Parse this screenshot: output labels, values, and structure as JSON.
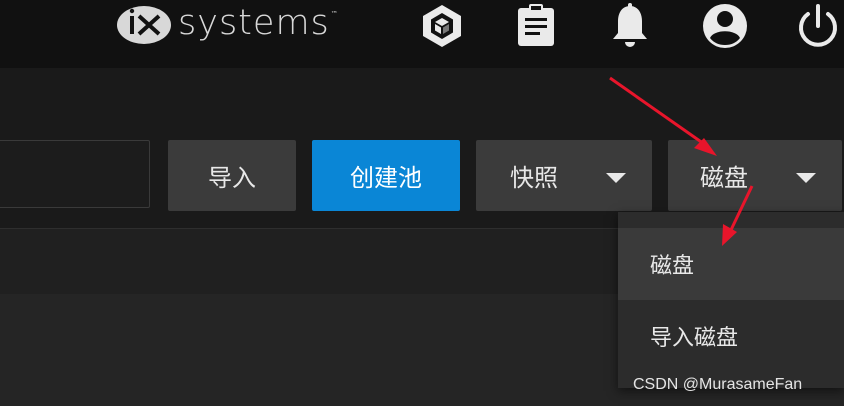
{
  "header": {
    "brand": "systems",
    "trademark": "™",
    "icons": [
      "truecommand-icon",
      "clipboard-icon",
      "bell-icon",
      "account-icon",
      "power-icon"
    ]
  },
  "toolbar": {
    "search_value": "",
    "import_label": "导入",
    "create_pool_label": "创建池",
    "snapshots_label": "快照",
    "disks_label": "磁盘"
  },
  "disks_menu": {
    "items": [
      "磁盘",
      "导入磁盘"
    ]
  },
  "watermark": "CSDN @MurasameFan",
  "colors": {
    "topbar": "#111111",
    "primary_button": "#0a86d6",
    "secondary_button": "#3b3b3b",
    "annotation_arrow": "#e8152b"
  }
}
